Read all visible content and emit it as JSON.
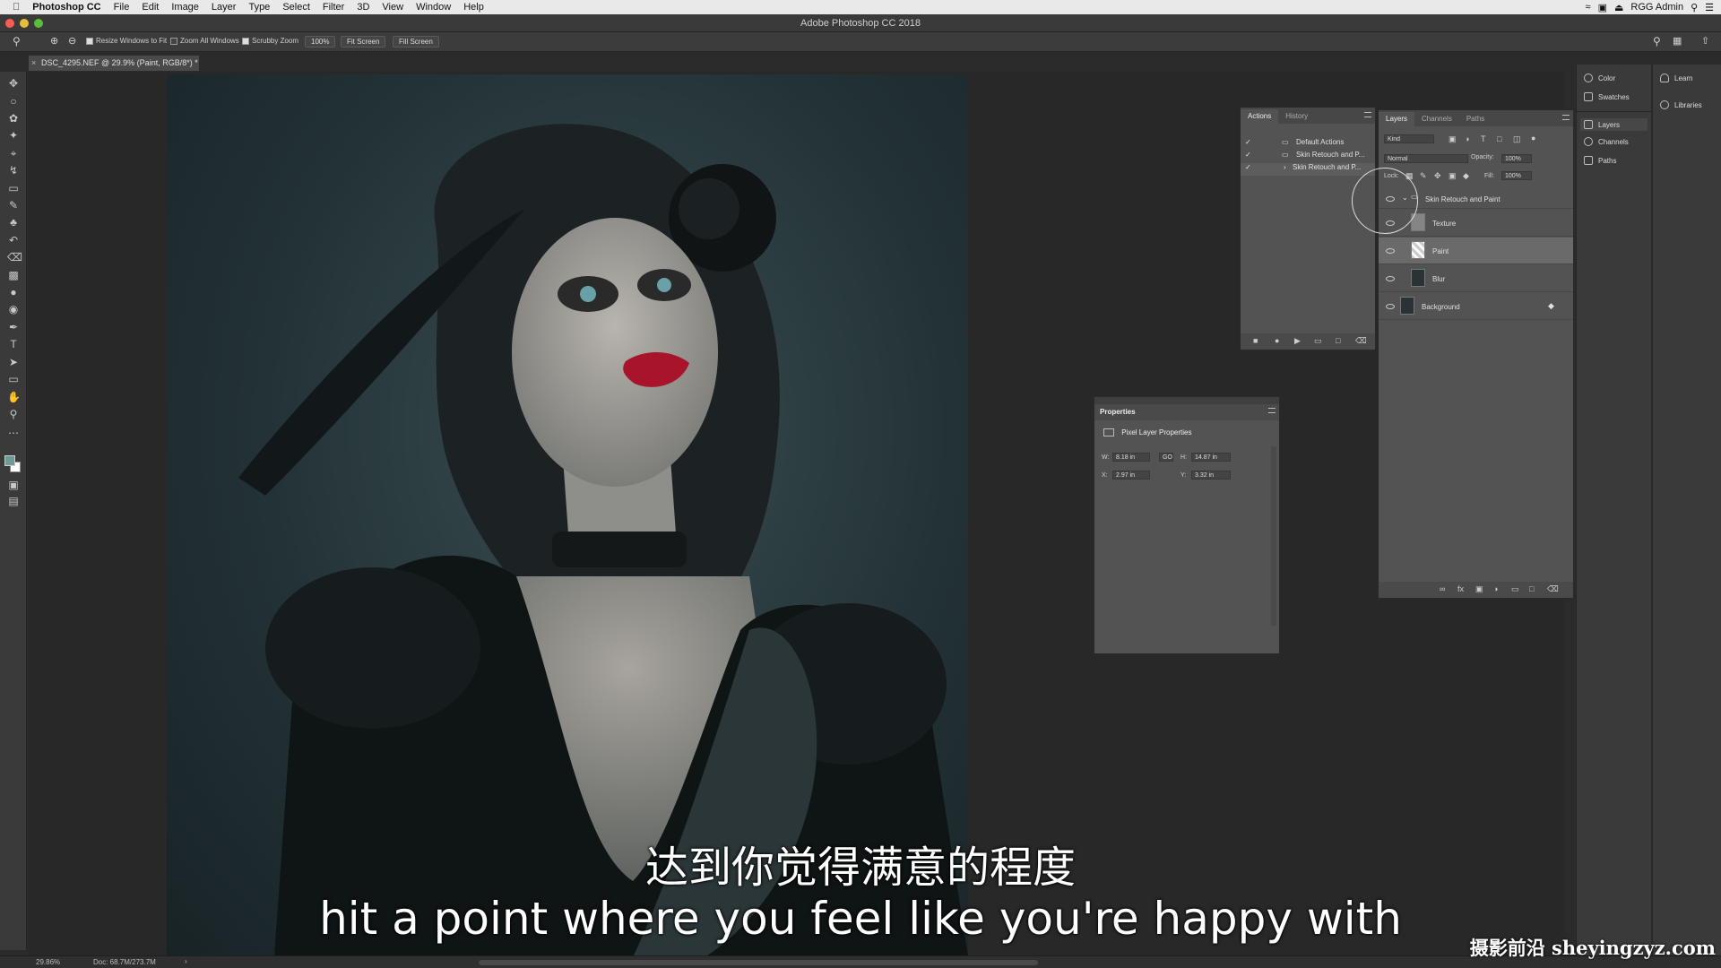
{
  "menubar": {
    "app": "Photoshop CC",
    "items": [
      "File",
      "Edit",
      "Image",
      "Layer",
      "Type",
      "Select",
      "Filter",
      "3D",
      "View",
      "Window",
      "Help"
    ],
    "user": "RGG Admin"
  },
  "window": {
    "title": "Adobe Photoshop CC 2018"
  },
  "options": {
    "resize_windows": "Resize Windows to Fit",
    "zoom_all": "Zoom All Windows",
    "scrubby": "Scrubby Zoom",
    "zoom_value": "100%",
    "fit_screen": "Fit Screen",
    "fill_screen": "Fill Screen"
  },
  "document": {
    "tab_title": "DSC_4295.NEF @ 29.9% (Paint, RGB/8*) *"
  },
  "status": {
    "zoom": "29.86%",
    "doc": "Doc: 68.7M/273.7M"
  },
  "actions_panel": {
    "tabs": [
      "Actions",
      "History"
    ],
    "items": [
      "Default Actions",
      "Skin Retouch and P...",
      "Skin Retouch and P..."
    ]
  },
  "layers_panel": {
    "tabs": [
      "Layers",
      "Channels",
      "Paths"
    ],
    "kind": "Kind",
    "blend_mode": "Normal",
    "opacity_label": "Opacity:",
    "opacity": "100%",
    "lock_label": "Lock:",
    "fill_label": "Fill:",
    "fill": "100%",
    "layers": [
      "Skin Retouch and Paint",
      "Texture",
      "Paint",
      "Blur",
      "Background"
    ]
  },
  "properties_panel": {
    "title": "Properties",
    "subtitle": "Pixel Layer Properties",
    "w_label": "W:",
    "w": "8.18 in",
    "h_label": "H:",
    "h": "14.87 in",
    "x_label": "X:",
    "x": "2.97 in",
    "y_label": "Y:",
    "y": "3.32 in",
    "link": "GO"
  },
  "dock": {
    "col1": [
      "Color",
      "Swatches",
      "Layers",
      "Channels",
      "Paths"
    ],
    "col2": [
      "Learn",
      "Libraries"
    ]
  },
  "subtitles": {
    "zh": "达到你觉得满意的程度",
    "en": "hit a point where you feel like you're happy with"
  },
  "watermark": "摄影前沿 sheyingzyz.com"
}
